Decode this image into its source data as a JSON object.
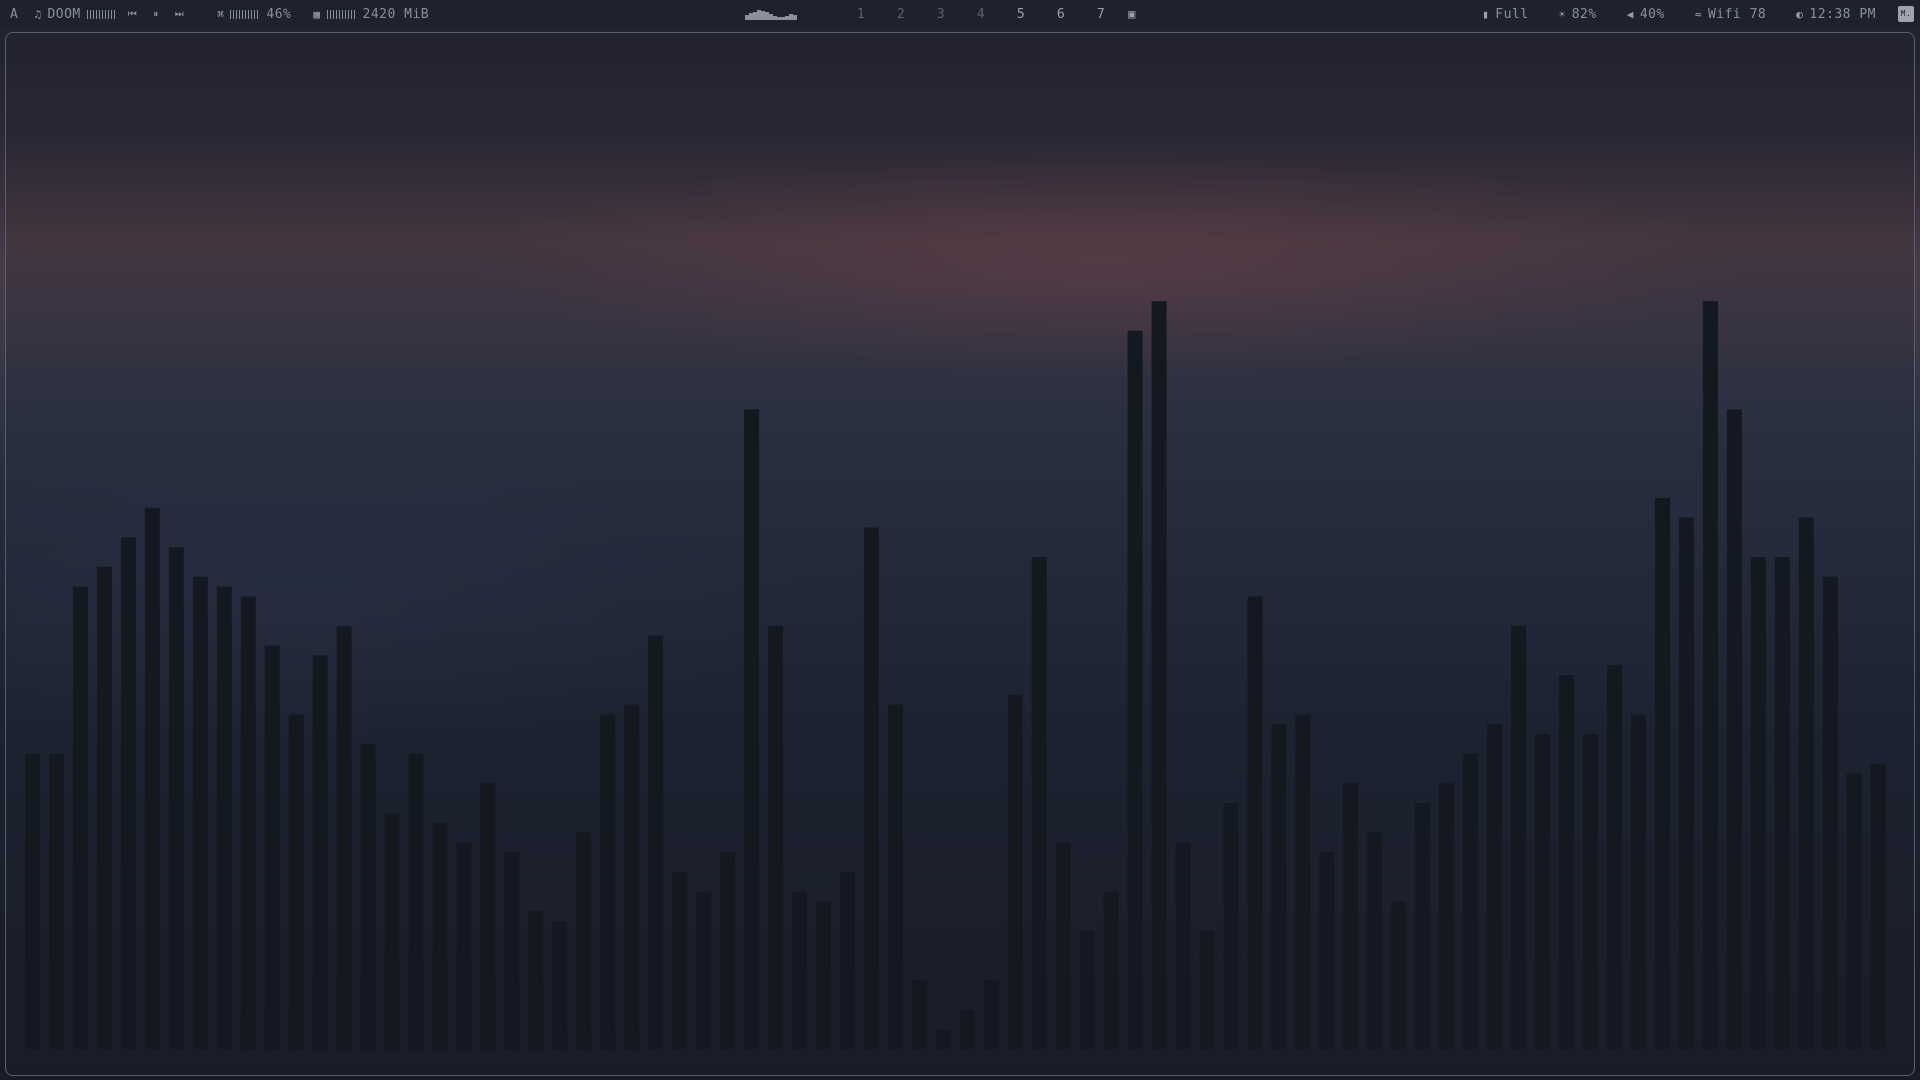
{
  "topbar": {
    "launcher": "A",
    "music": {
      "icon": "music-note-icon",
      "title": "DOOM"
    },
    "cpu": {
      "icon": "cpu-icon",
      "value": "46%"
    },
    "memory": {
      "icon": "memory-icon",
      "value": "2420 MiB"
    },
    "workspaces": [
      "1",
      "2",
      "3",
      "4",
      "5",
      "6",
      "7"
    ],
    "occupied_workspaces": [
      "5",
      "6",
      "7"
    ],
    "layout_icon": "monocle-layout-icon",
    "battery": {
      "icon": "battery-icon",
      "value": "Full"
    },
    "brightness": {
      "icon": "brightness-icon",
      "value": "82%"
    },
    "volume": {
      "icon": "speaker-icon",
      "value": "40%"
    },
    "wifi": {
      "icon": "wifi-icon",
      "value": "Wifi 78"
    },
    "clock": {
      "icon": "clock-icon",
      "value": "12:38 PM"
    },
    "corner_label": "M."
  },
  "colors": {
    "bar_bg": "#1e222c",
    "text": "#8a8f9c",
    "visualizer_bar": "#141820",
    "window_border": "#5a5e6a"
  },
  "visualizer": {
    "levels": [
      0.3,
      0.3,
      0.47,
      0.49,
      0.52,
      0.55,
      0.51,
      0.48,
      0.47,
      0.46,
      0.41,
      0.34,
      0.4,
      0.43,
      0.31,
      0.24,
      0.3,
      0.23,
      0.21,
      0.27,
      0.2,
      0.14,
      0.13,
      0.22,
      0.34,
      0.35,
      0.42,
      0.18,
      0.16,
      0.2,
      0.65,
      0.43,
      0.16,
      0.15,
      0.18,
      0.53,
      0.35,
      0.07,
      0.02,
      0.04,
      0.07,
      0.36,
      0.5,
      0.21,
      0.12,
      0.16,
      0.73,
      0.76,
      0.21,
      0.12,
      0.25,
      0.46,
      0.33,
      0.34,
      0.2,
      0.27,
      0.22,
      0.15,
      0.25,
      0.27,
      0.3,
      0.33,
      0.43,
      0.32,
      0.38,
      0.32,
      0.39,
      0.34,
      0.56,
      0.54,
      0.76,
      0.65,
      0.5,
      0.5,
      0.54,
      0.48,
      0.28,
      0.29
    ]
  }
}
